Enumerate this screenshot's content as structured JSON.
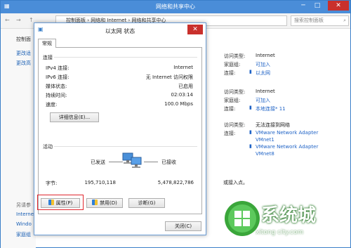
{
  "window": {
    "title": "网络和共享中心"
  },
  "address": {
    "path": "控制面板 › 网络和 Internet › 网络和共享中心",
    "search_placeholder": "搜索控制面板"
  },
  "left": {
    "home": "控制面",
    "links": [
      "更改适",
      "更改高"
    ],
    "see_also_title": "另请参",
    "see_also": [
      "Internet",
      "Windo",
      "家庭组"
    ]
  },
  "connections": [
    {
      "access_label": "访问类型:",
      "access": "Internet",
      "homegroup_label": "家庭组:",
      "homegroup": "可加入",
      "conn_label": "连接:",
      "conn": "以太网"
    },
    {
      "access_label": "访问类型:",
      "access": "Internet",
      "homegroup_label": "家庭组:",
      "homegroup": "可加入",
      "conn_label": "连接:",
      "conn": "本地连接* 11"
    },
    {
      "access_label": "访问类型:",
      "access": "无法连接到网络",
      "conn_label": "连接:",
      "conn": [
        "VMware Network Adapter",
        "VMnet1",
        "VMware Network Adapter",
        "VMnet8"
      ]
    }
  ],
  "bg_text": {
    "hint": "或接入点。"
  },
  "dialog": {
    "title": "以太网 状态",
    "tab": "常规",
    "connection_section": "连接",
    "rows": [
      {
        "label": "IPv4 连接:",
        "value": "Internet"
      },
      {
        "label": "IPv6 连接:",
        "value": "无 Internet 访问权限"
      },
      {
        "label": "媒体状态:",
        "value": "已启用"
      },
      {
        "label": "持续时间:",
        "value": "02:03:14"
      },
      {
        "label": "速度:",
        "value": "100.0 Mbps"
      }
    ],
    "details_button": "详细信息(E)...",
    "activity_section": "活动",
    "sent_label": "已发送",
    "received_label": "已接收",
    "bytes_label": "字节:",
    "bytes_sent": "195,710,118",
    "bytes_received": "5,478,822,786",
    "properties_button": "属性(P)",
    "disable_button": "禁用(D)",
    "diagnose_button": "诊断(G)",
    "close_button": "关闭(C)"
  },
  "watermark": {
    "brand": "系统城",
    "url": "xitong city.com"
  }
}
